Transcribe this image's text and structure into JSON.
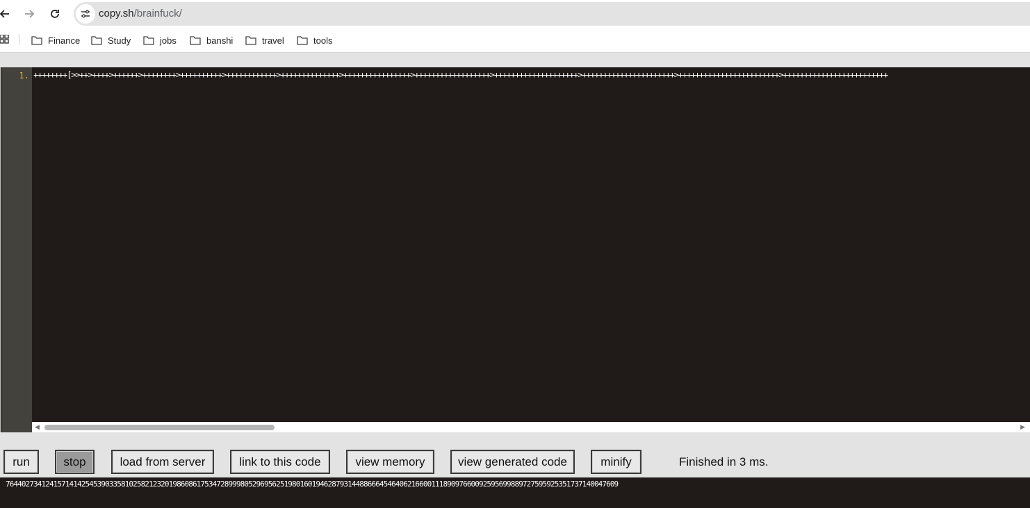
{
  "browser": {
    "url_host": "copy.sh",
    "url_path": "/brainfuck/"
  },
  "bookmarks": [
    {
      "label": "Finance"
    },
    {
      "label": "Study"
    },
    {
      "label": "jobs"
    },
    {
      "label": "banshi"
    },
    {
      "label": "travel"
    },
    {
      "label": "tools"
    }
  ],
  "editor": {
    "line_number": "1.",
    "code": "++++++++[>>++>++++>++++++>++++++++>++++++++++>++++++++++++>++++++++++++++>++++++++++++++++>++++++++++++++++++>++++++++++++++++++++>++++++++++++++++++++++>++++++++++++++++++++++++>+++++++++++++++++++++++++"
  },
  "controls": {
    "run": "run",
    "stop": "stop",
    "load_from_server": "load from server",
    "link_to_code": "link to this code",
    "view_memory": "view memory",
    "view_generated_code": "view generated code",
    "minify": "minify",
    "status": "Finished in 3 ms."
  },
  "output": {
    "text": "7644027341241571414254539033581025821232019860861753472899980529695625198016019462879314488666454640621660011189097660092595699889727595925351737140047609"
  },
  "colors": {
    "editor_bg": "#201b19",
    "gutter_bg": "#43423c",
    "line_number": "#e3b341",
    "stop_pressed": "#9a9a9a"
  }
}
